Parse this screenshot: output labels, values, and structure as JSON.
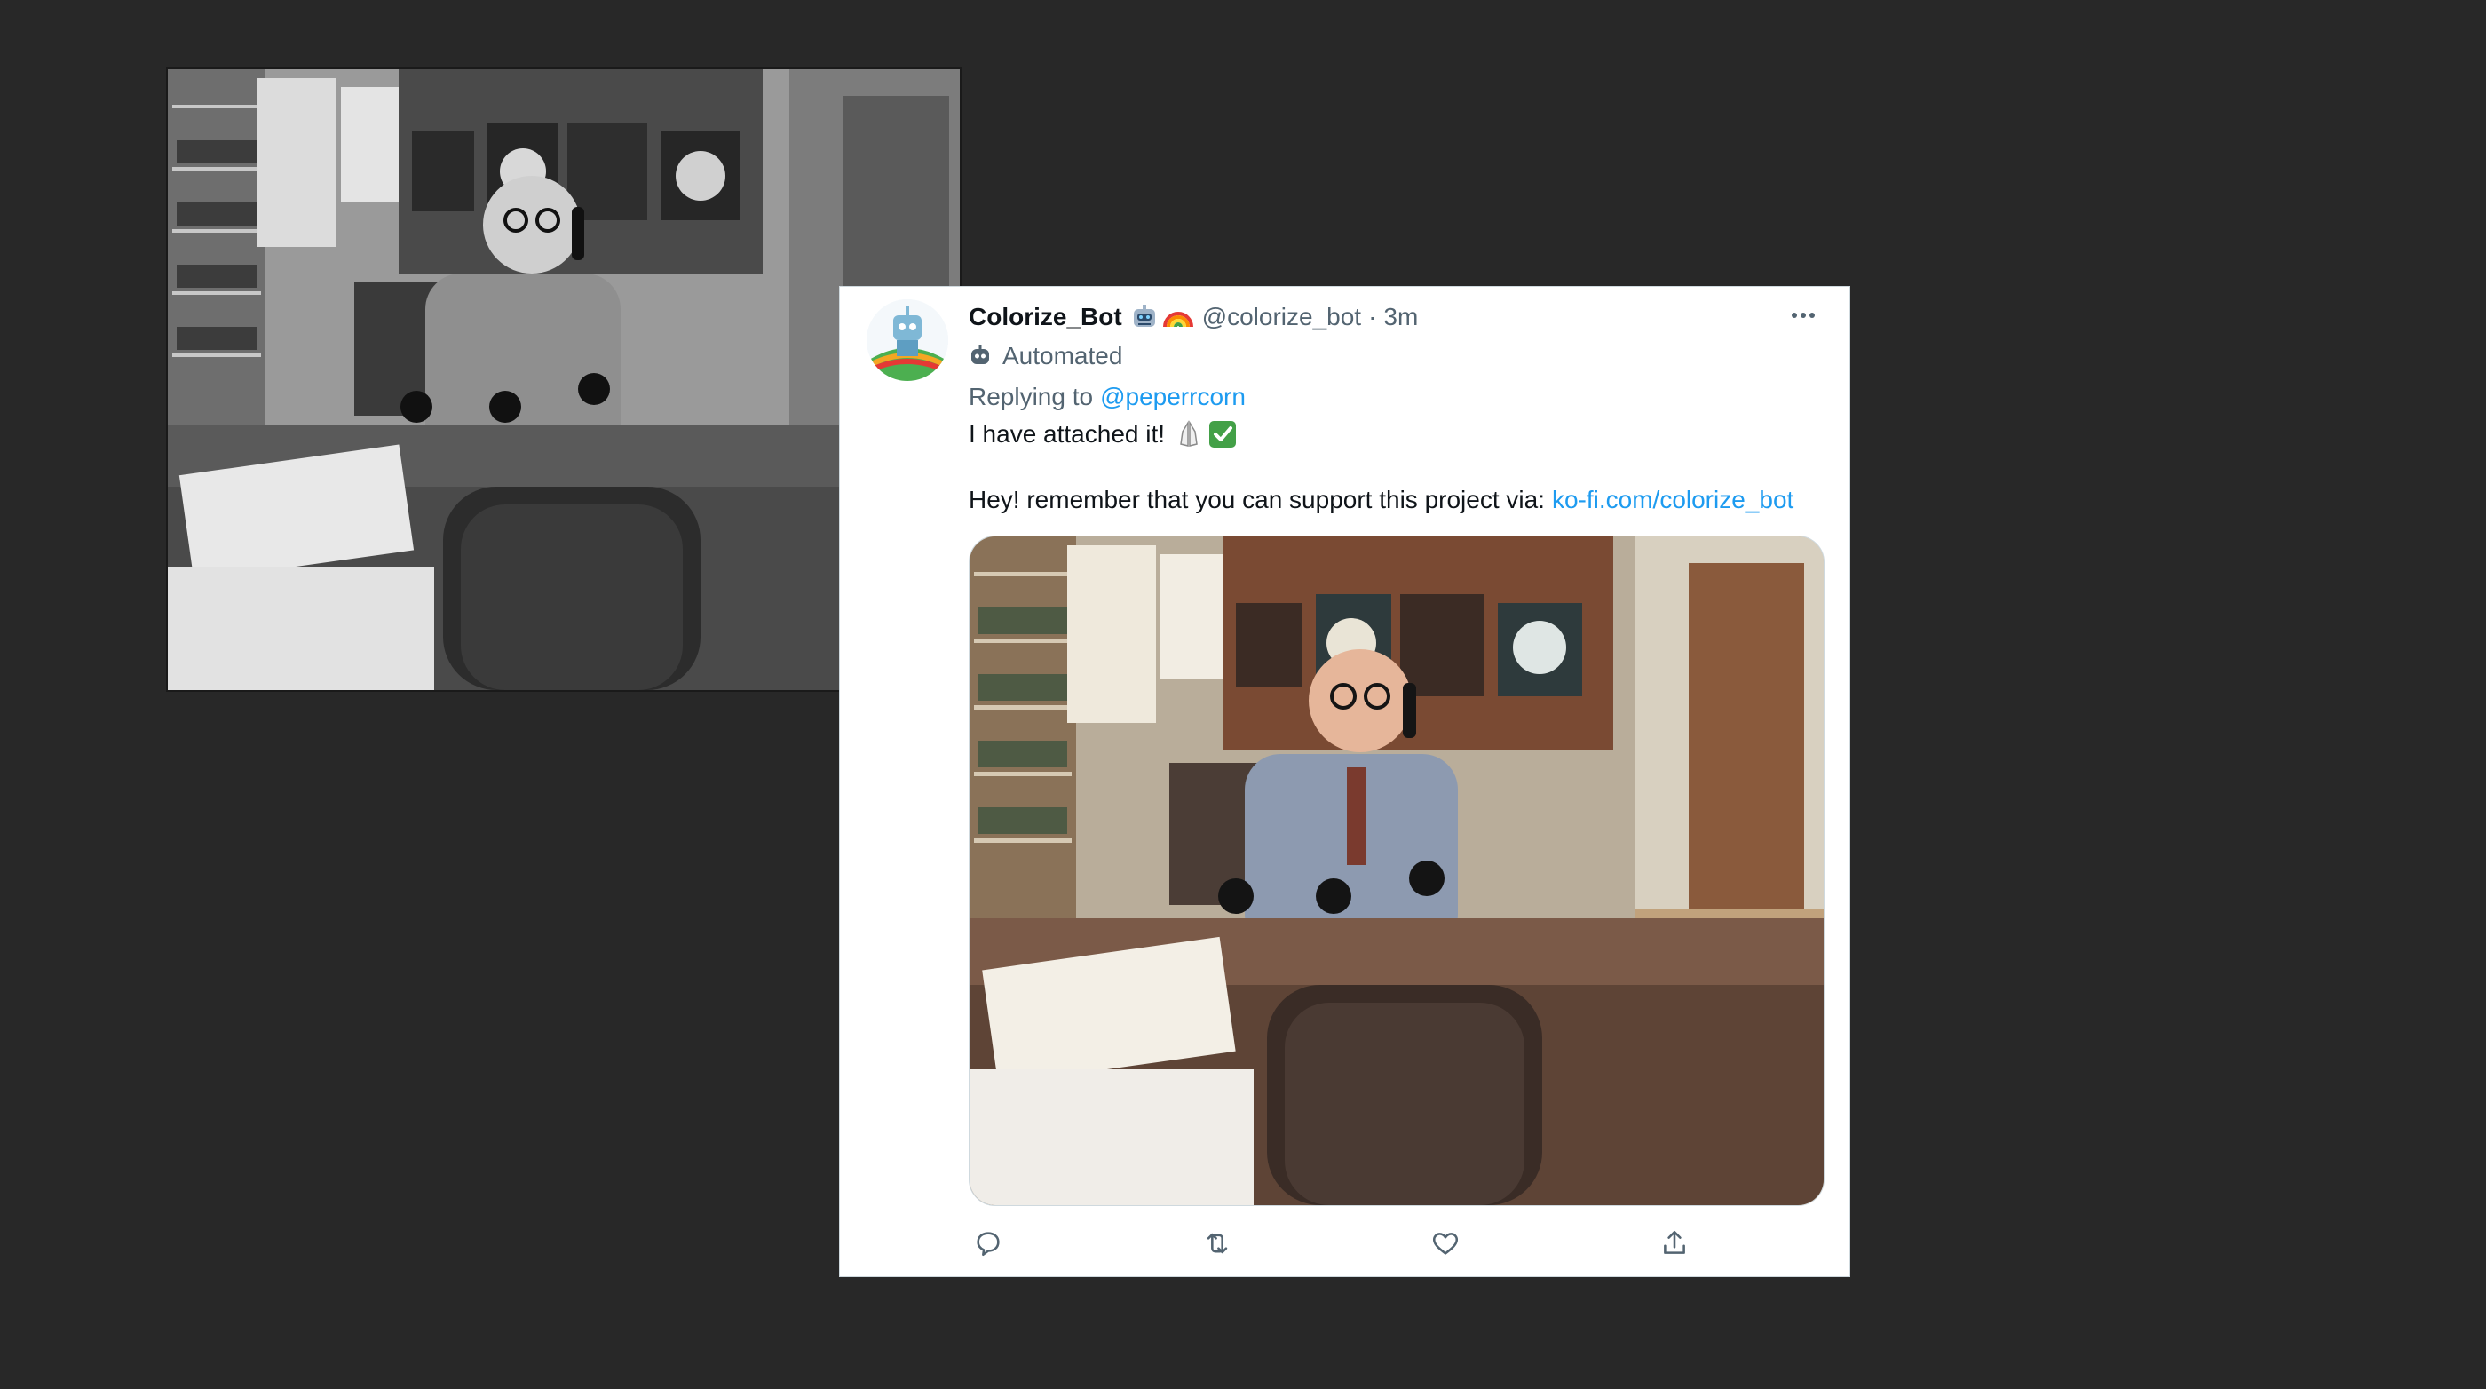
{
  "tweet": {
    "display_name": "Colorize_Bot",
    "name_emojis": [
      "robot-icon",
      "rainbow-icon"
    ],
    "handle": "@colorize_bot",
    "separator": "·",
    "timestamp": "3m",
    "automated_label": "Automated",
    "replying_to_prefix": "Replying to",
    "replying_to_mention": "@peperrcorn",
    "text_line_1": "I have attached it!",
    "text_line_1_emojis": [
      "praying-hands-icon",
      "check-mark-icon"
    ],
    "text_line_2_prefix": "Hey! remember that you can support this project via:",
    "text_line_2_link": "ko-fi.com/colorize_bot",
    "actions": [
      "reply-icon",
      "retweet-icon",
      "like-icon",
      "share-icon"
    ]
  },
  "images": {
    "original": "black-and-white photo of a man on the telephone at a desk",
    "colorized": "colorized photo of a man on the telephone at a desk"
  },
  "colors": {
    "background": "#282828",
    "link": "#1d9bf0",
    "secondary_text": "#536471",
    "primary_text": "#0f1419",
    "card": "#ffffff"
  }
}
